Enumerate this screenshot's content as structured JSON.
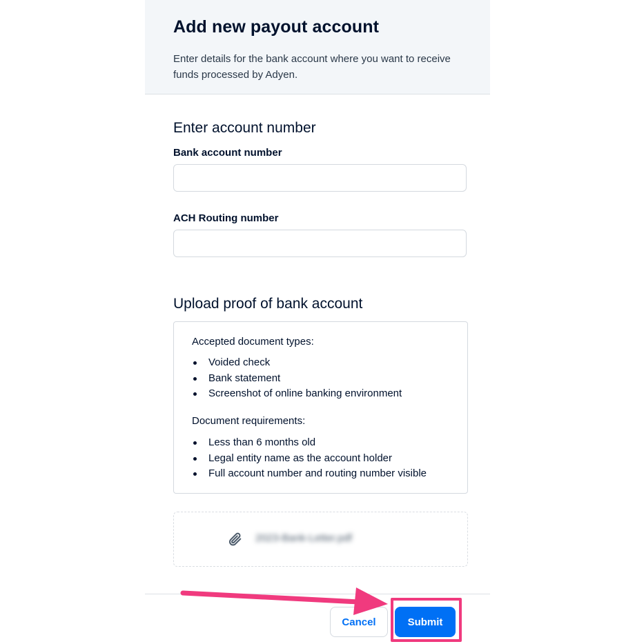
{
  "header": {
    "title": "Add new payout account",
    "subtitle": "Enter details for the bank account where you want to receive funds processed by Adyen."
  },
  "account_section": {
    "title": "Enter account number",
    "bank_account_label": "Bank account number",
    "bank_account_value": "",
    "routing_label": "ACH Routing number",
    "routing_value": ""
  },
  "upload_section": {
    "title": "Upload proof of bank account",
    "accepted_heading": "Accepted document types:",
    "accepted_items": [
      "Voided check",
      "Bank statement",
      "Screenshot of online banking environment"
    ],
    "requirements_heading": "Document requirements:",
    "requirements_items": [
      "Less than 6 months old",
      "Legal entity name as the account holder",
      "Full account number and routing number visible"
    ],
    "uploaded_file_icon": "paperclip-icon",
    "uploaded_file_name": "2023-Bank-Letter.pdf"
  },
  "footer": {
    "cancel_label": "Cancel",
    "submit_label": "Submit"
  },
  "colors": {
    "primary": "#0070f5",
    "header_bg": "#f3f6f9",
    "annotation": "#f03a7e"
  }
}
